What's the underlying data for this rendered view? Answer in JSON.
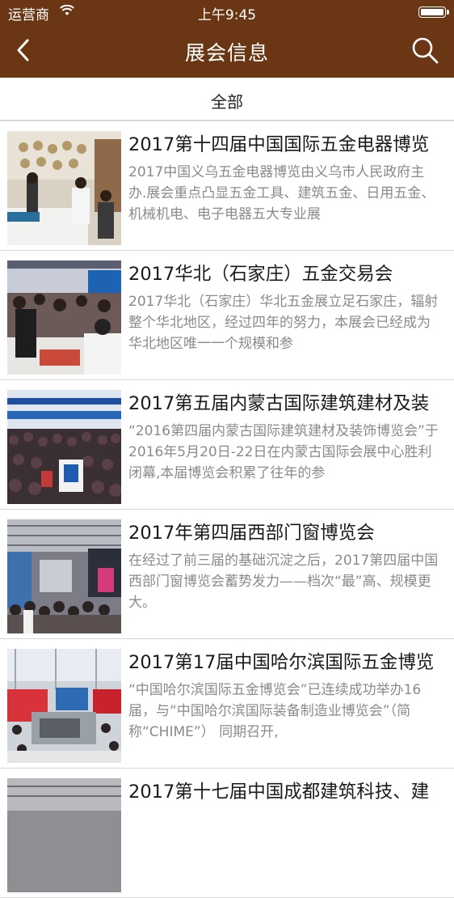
{
  "status_bar": {
    "carrier": "运营商",
    "time": "上午9:45"
  },
  "navbar": {
    "title": "展会信息",
    "back_icon": "chevron-left-icon",
    "search_icon": "search-icon"
  },
  "filter": {
    "label": "全部"
  },
  "colors": {
    "header_bg": "#6b3613",
    "title_text": "#1a1a1a",
    "desc_text": "#8a8a8a"
  },
  "exhibitions": [
    {
      "title": "2017第十四届中国国际五金电器博览",
      "desc": "2017中国义乌五金电器博览由义乌市人民政府主办.展会重点凸显五金工具、建筑五金、日用五金、机械机电、电子电器五大专业展"
    },
    {
      "title": "2017华北（石家庄）五金交易会",
      "desc": "2017华北（石家庄）华北五金展立足石家庄，辐射整个华北地区，经过四年的努力，本展会已经成为华北地区唯一一个规模和参"
    },
    {
      "title": "2017第五届内蒙古国际建筑建材及装",
      "desc": "“2016第四届内蒙古国际建筑建材及装饰博览会”于2016年5月20日-22日在内蒙古国际会展中心胜利闭幕,本届博览会积累了往年的参"
    },
    {
      "title": "2017年第四届西部门窗博览会",
      "desc": "在经过了前三届的基础沉淀之后，2017第四届中国西部门窗博览会蓄势发力——档次“最”高、规模更大。"
    },
    {
      "title": "2017第17届中国哈尔滨国际五金博览",
      "desc": "“中国哈尔滨国际五金博览会”已连续成功举办16届，与“中国哈尔滨国际装备制造业博览会”（简称“CHIME”） 同期召开,"
    },
    {
      "title": "2017第十七届中国成都建筑科技、建",
      "desc": ""
    }
  ]
}
